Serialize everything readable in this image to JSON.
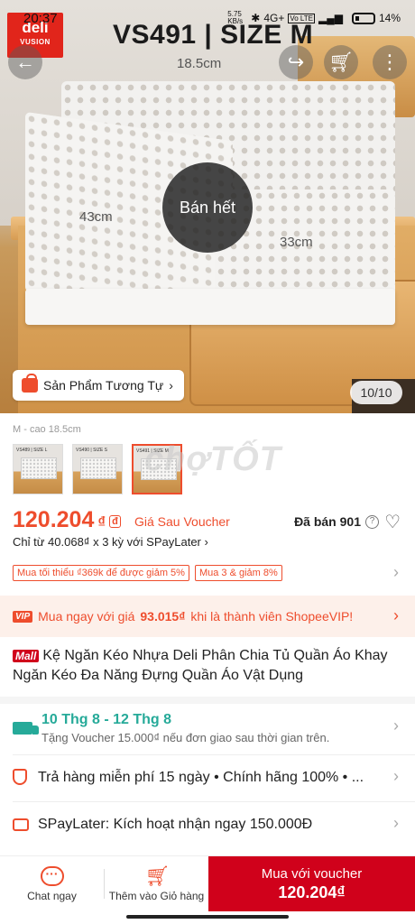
{
  "status_bar": {
    "time": "20:37",
    "network_speed": "5.75 KB/s",
    "signal": "4G+",
    "volte": "Vo LTE",
    "battery": "14%"
  },
  "header": {
    "brand_logo": "deli",
    "brand_sub": "VUSION",
    "product_code": "VS491 | SIZE M"
  },
  "image": {
    "dimension_top": "18.5cm",
    "dimension_left": "43cm",
    "dimension_right": "33cm",
    "sold_out": "Bán hết",
    "similar_label": "Sản Phẩm Tương Tự",
    "pager": "10/10"
  },
  "nav_icons": {
    "back": "arrow-left-icon",
    "share": "share-icon",
    "cart": "cart-icon",
    "more": "more-vertical-icon"
  },
  "variants": {
    "label": "M - cao 18.5cm",
    "thumbs": [
      {
        "label": "VS489 | SIZE L"
      },
      {
        "label": "VS490 | SIZE S"
      },
      {
        "label": "VS491 | SIZE M"
      }
    ],
    "watermark": "chợTỐT"
  },
  "price": {
    "amount": "120.204",
    "currency": "₫",
    "tag": "đ",
    "note": "Giá Sau Voucher",
    "sold": "Đã bán 901",
    "spaylater": "Chỉ từ 40.068₫ x 3 kỳ với SPayLater"
  },
  "vouchers": [
    "Mua tối thiểu ₫369k để được giảm 5%",
    "Mua 3 & giảm 8%"
  ],
  "vip": {
    "badge": "VIP",
    "text_before": "Mua ngay với giá",
    "price": "93.015₫",
    "text_after": "khi là thành viên ShopeeVIP!"
  },
  "title": {
    "mall": "Mall",
    "text": "Kệ Ngăn Kéo Nhựa Deli Phân Chia Tủ Quần Áo Khay Ngăn Kéo Đa Năng Đựng Quần Áo Vật Dụng"
  },
  "shipping": {
    "dates": "10 Thg 8 - 12 Thg 8",
    "voucher_note": "Tặng Voucher 15.000₫ nếu đơn giao sau thời gian trên."
  },
  "guarantee": "Trả hàng miễn phí 15 ngày  •  Chính hãng 100%  •  ...",
  "spaylater_row": "SPayLater: Kích hoạt nhận ngay 150.000Đ",
  "bottom_bar": {
    "chat": "Chat ngay",
    "add_cart": "Thêm vào Giỏ hàng",
    "buy_line1": "Mua với voucher",
    "buy_line2": "120.204₫"
  },
  "colors": {
    "accent": "#ee4d2d",
    "mall": "#d0011b",
    "shipping": "#26aa99"
  }
}
